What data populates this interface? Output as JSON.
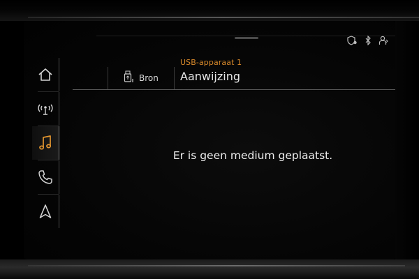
{
  "header": {
    "device_label": "USB-apparaat 1",
    "track_title": "Aanwijzing",
    "source_label": "Bron"
  },
  "sidebar": {
    "items": [
      {
        "id": "home",
        "icon": "home-icon",
        "active": false
      },
      {
        "id": "radio",
        "icon": "radio-antenna-icon",
        "active": false
      },
      {
        "id": "media",
        "icon": "music-note-icon",
        "active": true
      },
      {
        "id": "phone",
        "icon": "phone-icon",
        "active": false
      },
      {
        "id": "navigation",
        "icon": "navigation-arrow-icon",
        "active": false
      }
    ]
  },
  "status_icons": [
    "location-shield-icon",
    "bluetooth-icon",
    "user-profile-icon"
  ],
  "main": {
    "message": "Er is geen medium geplaatst."
  },
  "colors": {
    "accent": "#d98a2b",
    "text": "#e6e6e6",
    "background": "#050505"
  }
}
